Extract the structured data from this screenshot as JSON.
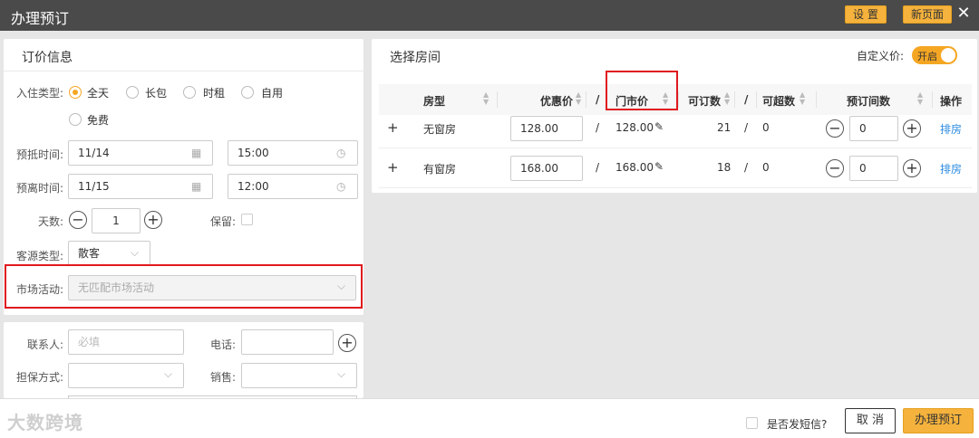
{
  "window": {
    "title": "办理预订",
    "settings_label": "设 置",
    "new_page_label": "新页面",
    "close_glyph": "✕"
  },
  "order_info": {
    "title": "订价信息",
    "checkin_type_label": "入住类型:",
    "checkin_types": [
      "全天",
      "长包",
      "时租",
      "自用",
      "免费"
    ],
    "arrive_label": "预抵时间:",
    "arrive_date": "11/14",
    "arrive_time": "15:00",
    "leave_label": "预离时间:",
    "leave_date": "11/15",
    "leave_time": "12:00",
    "days_label": "天数:",
    "days_value": "1",
    "reserve_label": "保留:",
    "source_label": "客源类型:",
    "source_value": "散客",
    "market_label": "市场活动:",
    "market_placeholder": "无匹配市场活动"
  },
  "contact": {
    "contact_label": "联系人:",
    "contact_placeholder": "必填",
    "phone_label": "电话:",
    "guarantee_label": "担保方式:",
    "sales_label": "销售:"
  },
  "rooms": {
    "title": "选择房间",
    "custom_price_label": "自定义价:",
    "toggle_label": "开启",
    "columns": {
      "type": "房型",
      "discount": "优惠价",
      "slash": "/",
      "rack": "门市价",
      "available": "可订数",
      "over": "可超数",
      "count": "预订间数",
      "action": "操作"
    },
    "rows": [
      {
        "expand": "+",
        "type": "无窗房",
        "discount": "128.00",
        "rack": "128.00",
        "available": "21",
        "over": "0",
        "count": "0",
        "action": "排房"
      },
      {
        "expand": "+",
        "type": "有窗房",
        "discount": "168.00",
        "rack": "168.00",
        "available": "18",
        "over": "0",
        "count": "0",
        "action": "排房"
      }
    ]
  },
  "footer": {
    "sms_label": "是否发短信?",
    "cancel_label": "取 消",
    "submit_label": "办理预订",
    "watermark": "大数跨境"
  },
  "colors": {
    "accent": "#f5a623",
    "title_bar": "#4a4a4a",
    "highlight": "#e0191f",
    "link": "#2a8be0"
  }
}
